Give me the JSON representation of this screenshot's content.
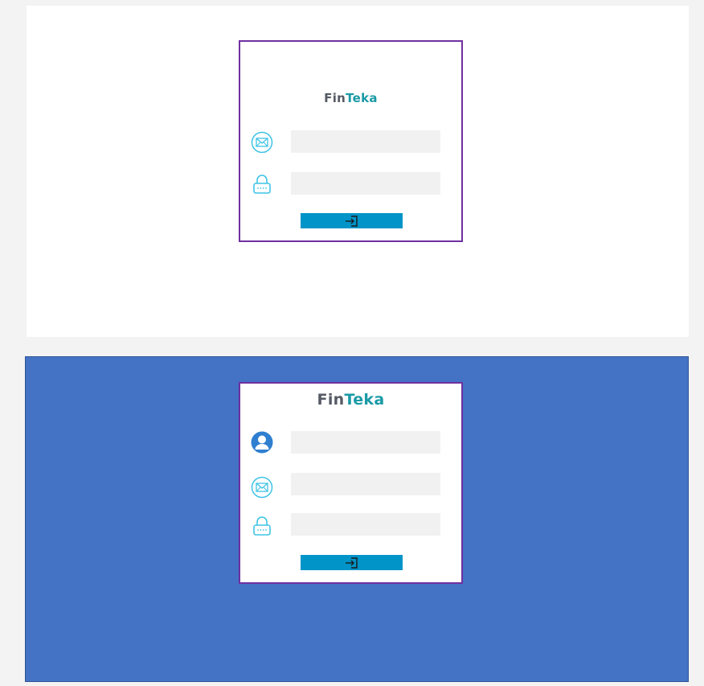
{
  "brand": {
    "part1": "Fin",
    "part2": "Teka"
  },
  "colors": {
    "page_background": "#f3f3f3",
    "bottom_panel": "#4472c4",
    "card_border": "#7030a0",
    "button": "#0094c8",
    "icon_line": "#3fc3e6",
    "user_icon": "#2f7fd0",
    "input_background": "#f1f1f1"
  },
  "login_form": {
    "email_icon": "envelope-icon",
    "password_icon": "padlock-icon",
    "email_value": "",
    "password_value": "",
    "submit_icon": "sign-in-icon"
  },
  "signup_form": {
    "name_icon": "user-icon",
    "email_icon": "envelope-icon",
    "password_icon": "padlock-icon",
    "name_value": "",
    "email_value": "",
    "password_value": "",
    "submit_icon": "sign-in-icon"
  }
}
